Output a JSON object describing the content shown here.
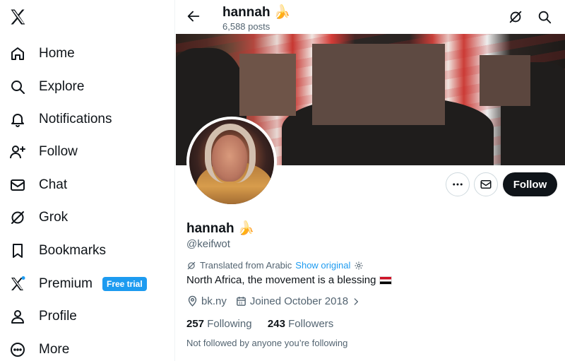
{
  "sidebar": {
    "items": [
      {
        "label": "Home",
        "icon": "home-icon"
      },
      {
        "label": "Explore",
        "icon": "search-icon"
      },
      {
        "label": "Notifications",
        "icon": "bell-icon"
      },
      {
        "label": "Follow",
        "icon": "person-add-icon"
      },
      {
        "label": "Chat",
        "icon": "envelope-icon"
      },
      {
        "label": "Grok",
        "icon": "grok-icon"
      },
      {
        "label": "Bookmarks",
        "icon": "bookmark-icon"
      },
      {
        "label": "Premium",
        "icon": "x-logo-icon",
        "badge": "Free trial"
      },
      {
        "label": "Profile",
        "icon": "person-icon"
      },
      {
        "label": "More",
        "icon": "more-circle-icon"
      }
    ]
  },
  "header": {
    "name": "hannah 🍌",
    "posts": "6,588 posts"
  },
  "profile": {
    "name": "hannah 🍌",
    "handle": "@keifwot",
    "translated_label": "Translated from Arabic",
    "show_original": "Show original",
    "bio": "North Africa, the movement is a blessing",
    "location": "bk.ny",
    "joined": "Joined October 2018",
    "following_count": "257",
    "following_label": "Following",
    "followers_count": "243",
    "followers_label": "Followers",
    "not_followed": "Not followed by anyone you’re following",
    "follow_label": "Follow"
  },
  "colors": {
    "accent": "#1d9bf0",
    "text": "#0f1419",
    "muted": "#536471"
  }
}
